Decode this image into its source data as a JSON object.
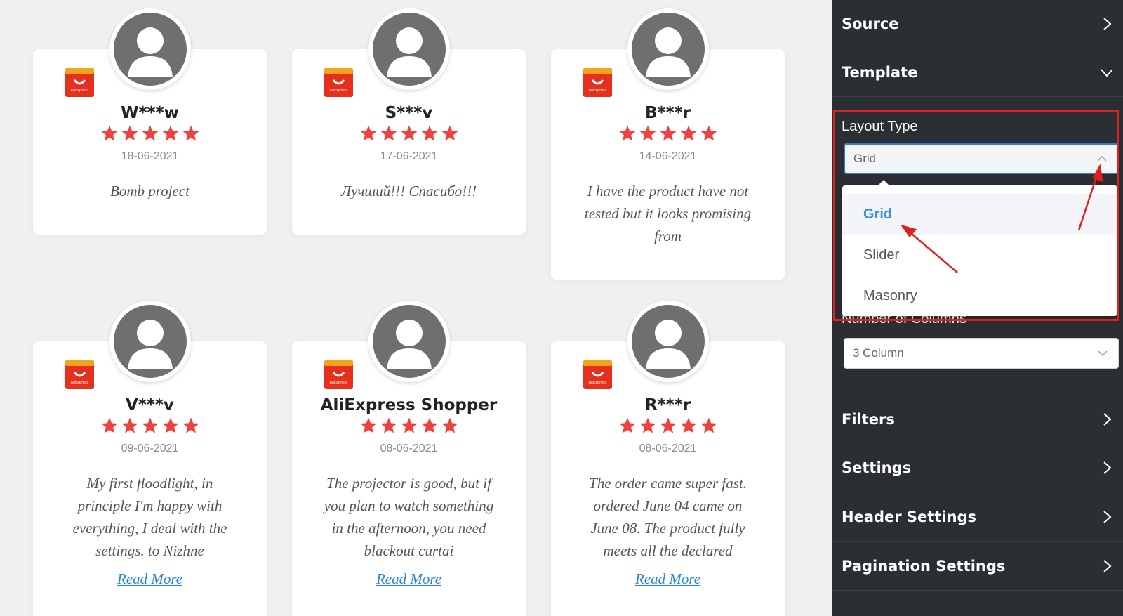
{
  "reviews": [
    {
      "name": "W***w",
      "rating": 5,
      "date": "18-06-2021",
      "text": "Bomb project",
      "read_more": ""
    },
    {
      "name": "S***v",
      "rating": 5,
      "date": "17-06-2021",
      "text": "Лучший!!! Спасибо!!!",
      "read_more": ""
    },
    {
      "name": "B***r",
      "rating": 5,
      "date": "14-06-2021",
      "text": "I have the product have not tested but it looks promising from",
      "read_more": ""
    },
    {
      "name": "V***v",
      "rating": 5,
      "date": "09-06-2021",
      "text": "My first floodlight, in principle I'm happy with everything, I deal with the settings. to Nizhne",
      "read_more": "Read More"
    },
    {
      "name": "AliExpress Shopper",
      "rating": 5,
      "date": "08-06-2021",
      "text": "The projector is good, but if you plan to watch something in the afternoon, you need blackout curtai",
      "read_more": "Read More"
    },
    {
      "name": "R***r",
      "rating": 5,
      "date": "08-06-2021",
      "text": "The order came super fast. ordered June 04 came on June 08. The product fully meets all the declared",
      "read_more": "Read More"
    }
  ],
  "source_logo": {
    "icon": "aliexpress-logo-icon",
    "text": "AliExpress",
    "color": "#e4301c"
  },
  "colors": {
    "star": "#f04141",
    "link": "#2a84d6",
    "sidebar_bg": "#2b2e33",
    "accent": "#3b8ee5",
    "annotation": "#e02020"
  },
  "sidebar": {
    "source": {
      "label": "Source"
    },
    "template": {
      "label": "Template"
    },
    "layout_type": {
      "label": "Layout Type",
      "value": "Grid",
      "options": [
        {
          "label": "Grid",
          "selected": true
        },
        {
          "label": "Slider",
          "selected": false
        },
        {
          "label": "Masonry",
          "selected": false
        }
      ]
    },
    "columns": {
      "label": "Number of Columns",
      "value": "3 Column"
    },
    "filters": {
      "label": "Filters"
    },
    "settings": {
      "label": "Settings"
    },
    "header_settings": {
      "label": "Header Settings"
    },
    "pagination_settings": {
      "label": "Pagination Settings"
    }
  }
}
